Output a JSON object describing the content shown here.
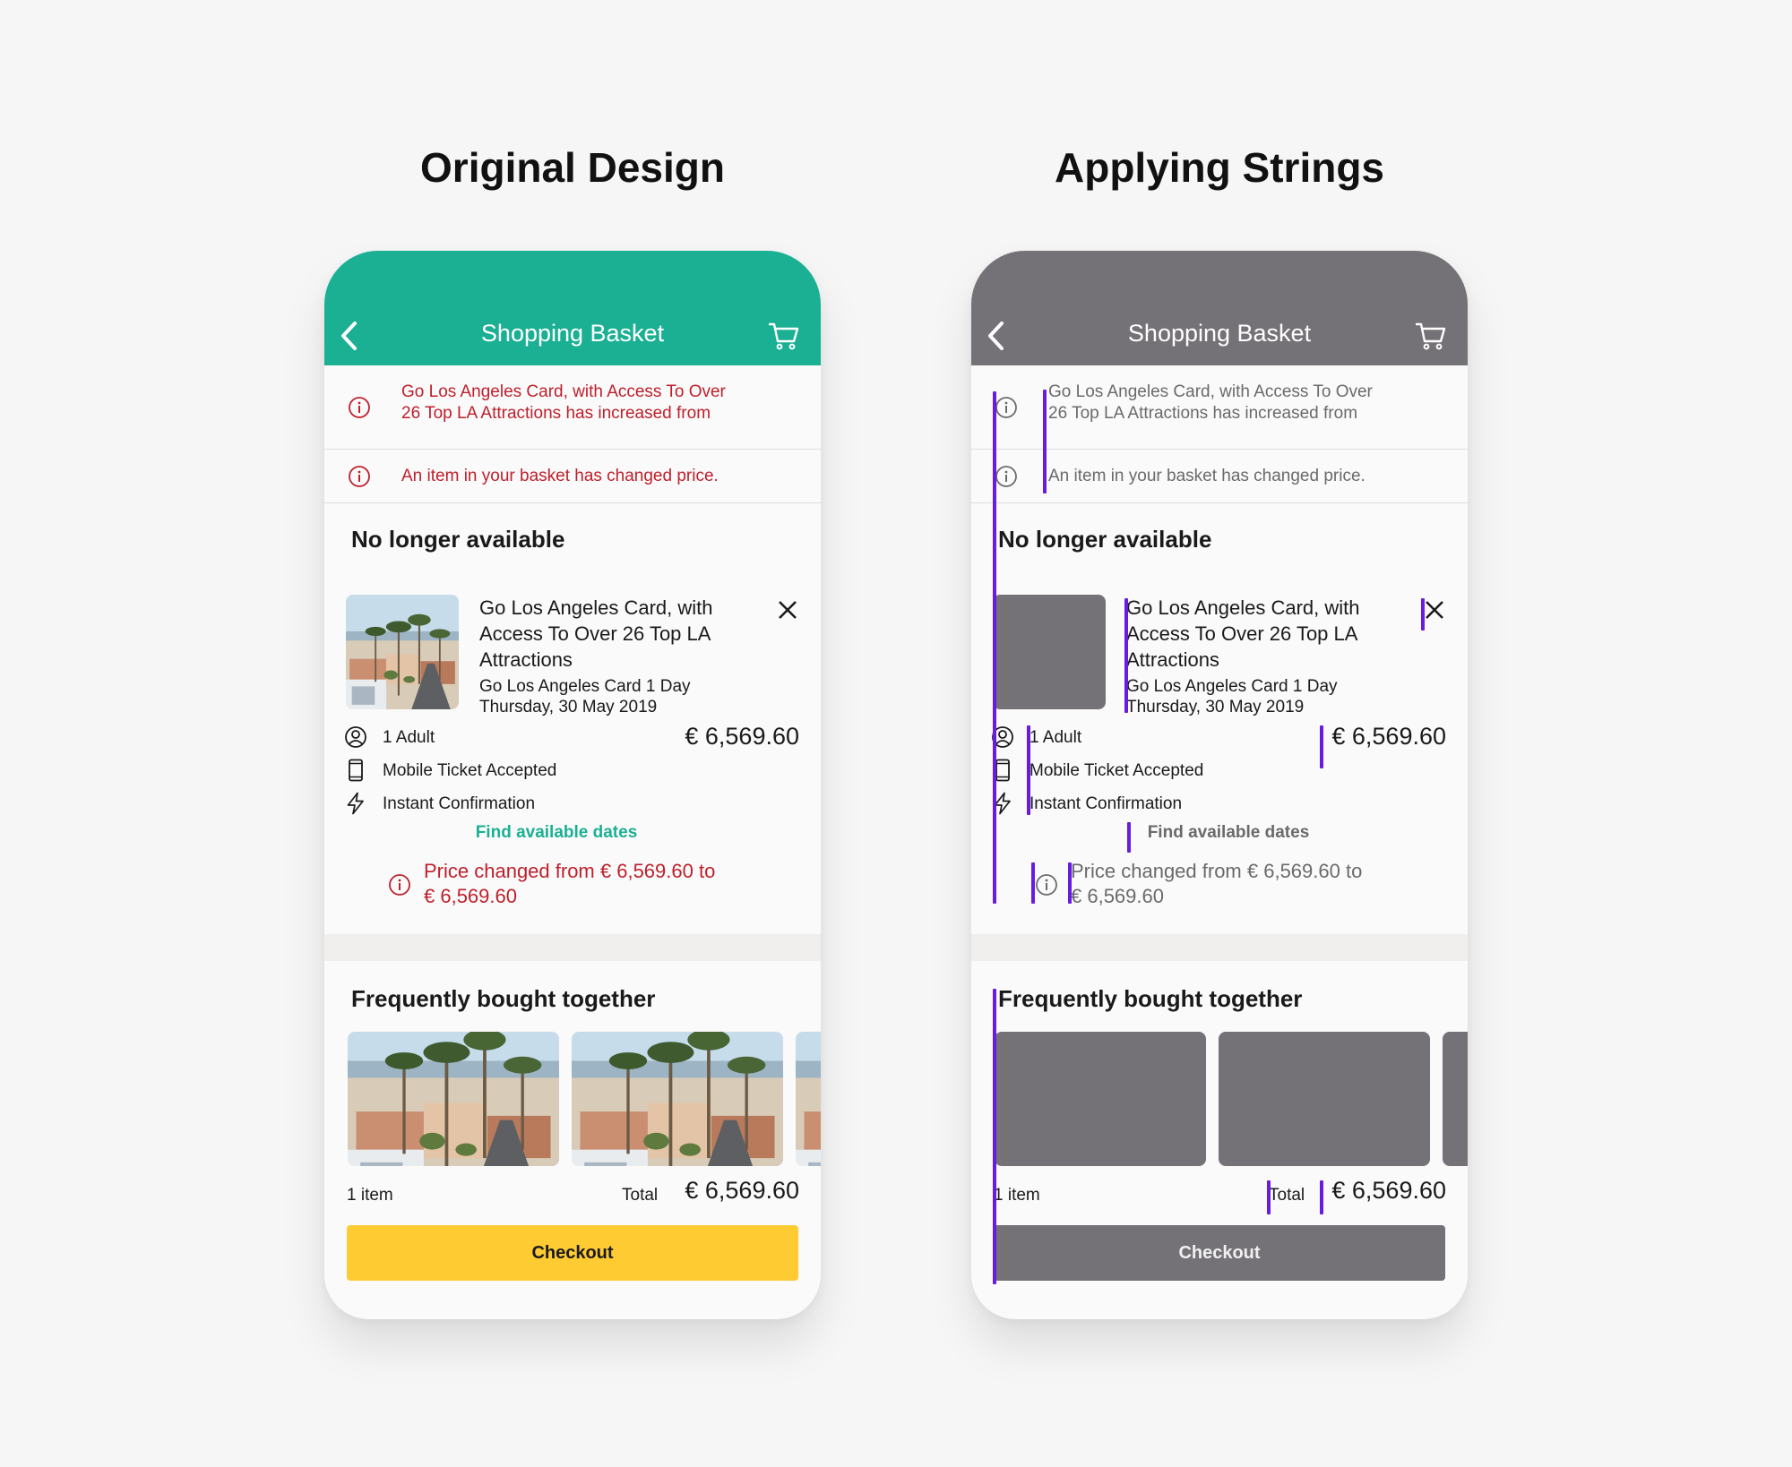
{
  "titles": {
    "left": "Original Design",
    "right": "Applying Strings"
  },
  "header": {
    "title": "Shopping Basket"
  },
  "alerts": {
    "first_line1": "Go Los Angeles Card, with Access To Over",
    "first_line2": "26 Top LA Attractions has increased from",
    "second": "An item in your basket has changed price."
  },
  "unavailable": {
    "heading": "No longer available",
    "product_title": "Go Los Angeles Card, with Access To Over 26 Top LA Attractions",
    "product_variant": "Go Los Angeles Card 1 Day",
    "product_date": "Thursday, 30 May 2019",
    "features": [
      "1 Adult",
      "Mobile Ticket Accepted",
      "Instant Confirmation"
    ],
    "price": "€ 6,569.60",
    "find_dates": "Find available dates",
    "price_change_line1": "Price changed from € 6,569.60 to",
    "price_change_line2": "€ 6,569.60"
  },
  "frequently": {
    "heading": "Frequently bought together",
    "item_count": "1 item",
    "total_label": "Total",
    "total_price": "€ 6,569.60",
    "checkout_label": "Checkout"
  },
  "colors": {
    "brand_green": "#1bb093",
    "placeholder_gray": "#757277",
    "error_red": "#bf1f2b",
    "checkout_yellow": "#fecb33",
    "string_marker_purple": "#6a1be0"
  },
  "icons": [
    "back-chevron-icon",
    "cart-icon",
    "info-icon",
    "close-icon",
    "person-icon",
    "mobile-phone-icon",
    "lightning-icon"
  ]
}
